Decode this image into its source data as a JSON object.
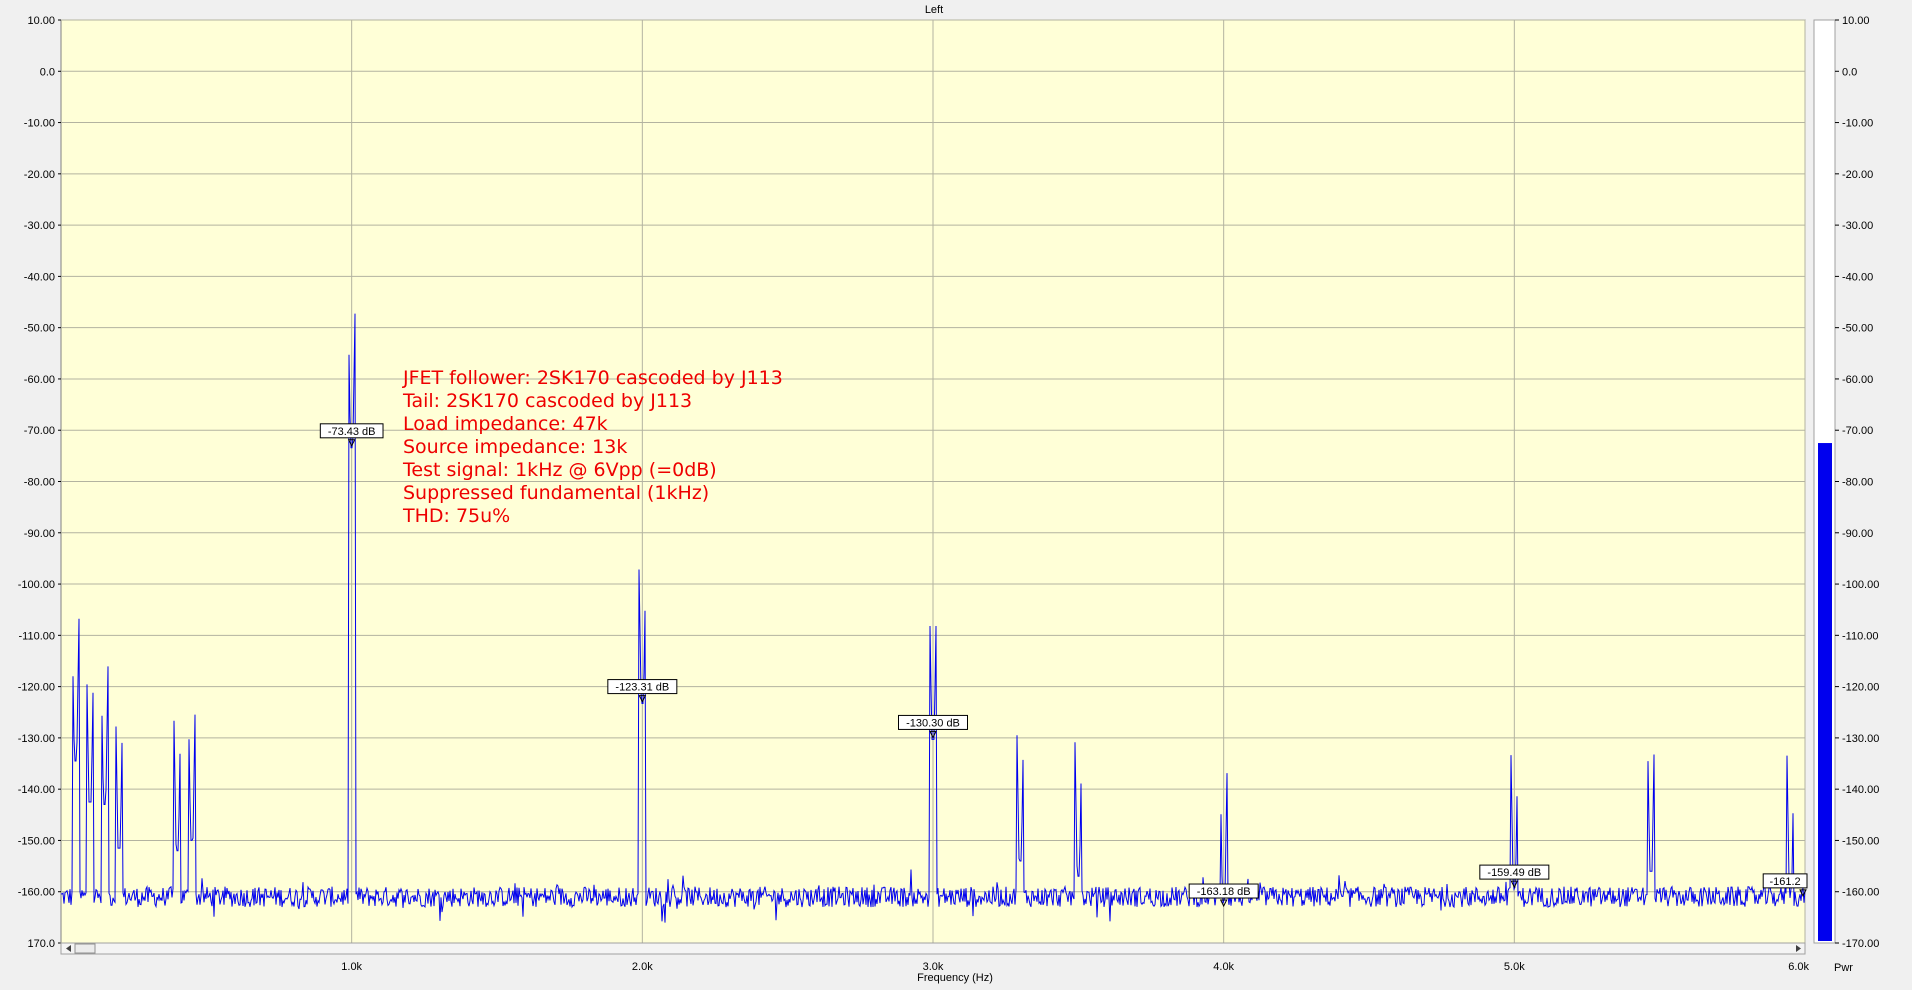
{
  "window": {
    "title": "Left"
  },
  "chart_data": {
    "type": "line",
    "title": "Left",
    "xlabel": "Frequency (Hz)",
    "ylabel": "",
    "xlim": [
      0,
      6000
    ],
    "ylim": [
      -170,
      10
    ],
    "grid": true,
    "y_ticks": [
      {
        "value": 10,
        "label": "10.00"
      },
      {
        "value": 0,
        "label": "0.0"
      },
      {
        "value": -10,
        "label": "-10.00"
      },
      {
        "value": -20,
        "label": "-20.00"
      },
      {
        "value": -30,
        "label": "-30.00"
      },
      {
        "value": -40,
        "label": "-40.00"
      },
      {
        "value": -50,
        "label": "-50.00"
      },
      {
        "value": -60,
        "label": "-60.00"
      },
      {
        "value": -70,
        "label": "-70.00"
      },
      {
        "value": -80,
        "label": "-80.00"
      },
      {
        "value": -90,
        "label": "-90.00"
      },
      {
        "value": -100,
        "label": "-100.00"
      },
      {
        "value": -110,
        "label": "-110.00"
      },
      {
        "value": -120,
        "label": "-120.00"
      },
      {
        "value": -130,
        "label": "-130.00"
      },
      {
        "value": -140,
        "label": "-140.00"
      },
      {
        "value": -150,
        "label": "-150.00"
      },
      {
        "value": -160,
        "label": "-160.00"
      },
      {
        "value": -170,
        "label": "-170.00"
      }
    ],
    "y_ticks_left": [
      {
        "value": 10,
        "label": "10.00"
      },
      {
        "value": 0,
        "label": "0.0"
      },
      {
        "value": -10,
        "label": "-10.00"
      },
      {
        "value": -20,
        "label": "-20.00"
      },
      {
        "value": -30,
        "label": "-30.00"
      },
      {
        "value": -40,
        "label": "-40.00"
      },
      {
        "value": -50,
        "label": "-50.00"
      },
      {
        "value": -60,
        "label": "-60.00"
      },
      {
        "value": -70,
        "label": "-70.00"
      },
      {
        "value": -80,
        "label": "-80.00"
      },
      {
        "value": -90,
        "label": "-90.00"
      },
      {
        "value": -100,
        "label": "-100.00"
      },
      {
        "value": -110,
        "label": "-110.00"
      },
      {
        "value": -120,
        "label": "-120.00"
      },
      {
        "value": -130,
        "label": "-130.00"
      },
      {
        "value": -140,
        "label": "-140.00"
      },
      {
        "value": -150,
        "label": "-150.00"
      },
      {
        "value": -160,
        "label": "-160.00"
      },
      {
        "value": -170,
        "label": "170.0"
      }
    ],
    "x_ticks": [
      {
        "value": 1000,
        "label": "1.0k"
      },
      {
        "value": 2000,
        "label": "2.0k"
      },
      {
        "value": 3000,
        "label": "3.0k"
      },
      {
        "value": 4000,
        "label": "4.0k"
      },
      {
        "value": 5000,
        "label": "5.0k"
      },
      {
        "value": 6000,
        "label": "6.0k"
      }
    ],
    "series": [
      {
        "color": "#0000ee",
        "noise_floor": -161,
        "peaks": [
          {
            "x": 50,
            "y": -134.5
          },
          {
            "x": 50,
            "y": -147
          },
          {
            "x": 100,
            "y": -142.5
          },
          {
            "x": 150,
            "y": -143
          },
          {
            "x": 200,
            "y": -151.5
          },
          {
            "x": 400,
            "y": -152
          },
          {
            "x": 450,
            "y": -150
          },
          {
            "x": 1000,
            "y": -73.4
          },
          {
            "x": 1000,
            "y": -103.5
          },
          {
            "x": 2000,
            "y": -123.3
          },
          {
            "x": 3000,
            "y": -130.3
          },
          {
            "x": 3300,
            "y": -154
          },
          {
            "x": 3500,
            "y": -157
          },
          {
            "x": 4000,
            "y": -163
          },
          {
            "x": 5000,
            "y": -159.5
          },
          {
            "x": 5470,
            "y": -156
          },
          {
            "x": 5950,
            "y": -161.2
          }
        ]
      }
    ],
    "markers": [
      {
        "x": 1000,
        "y": -73.43,
        "label": "-73.43 dB"
      },
      {
        "x": 2000,
        "y": -123.31,
        "label": "-123.31 dB"
      },
      {
        "x": 3000,
        "y": -130.3,
        "label": "-130.30 dB"
      },
      {
        "x": 4000,
        "y": -163.18,
        "label": "-163.18 dB"
      },
      {
        "x": 5000,
        "y": -159.49,
        "label": "-159.49 dB"
      },
      {
        "x": 6000,
        "y": -161.2,
        "label": "-161.2"
      }
    ],
    "annotation_lines": [
      "JFET follower: 2SK170 cascoded by J113",
      "Tail: 2SK170 cascoded by J113",
      "Load impedance: 47k",
      "Source impedance: 13k",
      "Test signal: 1kHz @ 6Vpp (=0dB)",
      "Suppressed fundamental (1kHz)",
      "THD: 75u%"
    ],
    "meter": {
      "label": "Pwr",
      "value": -72.5,
      "ylim": [
        -170,
        10
      ],
      "color": "#0000ee"
    }
  },
  "colors": {
    "plot_bg": "#ffffd7",
    "grid": "#b3b3a0",
    "trace": "#0000ee",
    "annotation": "#ee0000",
    "frame": "#f0f0f0"
  }
}
